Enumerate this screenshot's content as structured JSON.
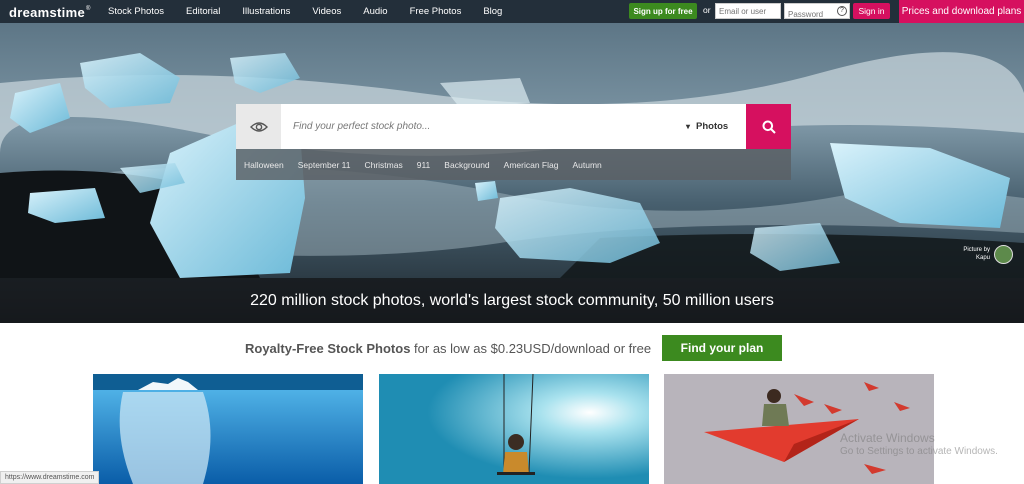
{
  "brand": {
    "name": "dreamstime",
    "mark": "®"
  },
  "nav": {
    "items": [
      "Stock Photos",
      "Editorial",
      "Illustrations",
      "Videos",
      "Audio",
      "Free Photos",
      "Blog"
    ]
  },
  "account": {
    "signup_label": "Sign up for free",
    "or_label": "or",
    "email_placeholder": "Email or user",
    "password_placeholder": "Password",
    "help_symbol": "?",
    "signin_label": "Sign in",
    "prices_label": "Prices and download plans"
  },
  "search": {
    "placeholder": "Find your perfect stock photo...",
    "type_selected": "Photos",
    "suggestions": [
      "Halloween",
      "September 11",
      "Christmas",
      "911",
      "Background",
      "American Flag",
      "Autumn"
    ]
  },
  "hero": {
    "credit_line1": "Picture by",
    "credit_line2": "Kapu",
    "tagline": "220 million stock photos, world's largest stock community, 50 million users"
  },
  "promo": {
    "bold": "Royalty-Free Stock Photos",
    "rest": " for as low as $0.23USD/download or free",
    "button": "Find your plan"
  },
  "status": {
    "url": "https://www.dreamstime.com"
  },
  "watermark": {
    "title": "Activate Windows",
    "subtitle": "Go to Settings to activate Windows."
  },
  "colors": {
    "topbar": "#232f3a",
    "accent_pink": "#d6105f",
    "accent_green": "#3c8a1f"
  },
  "icons": {
    "eye": "eye-icon",
    "search": "search-icon",
    "chevron": "chevron-down-icon",
    "help": "help-icon"
  }
}
